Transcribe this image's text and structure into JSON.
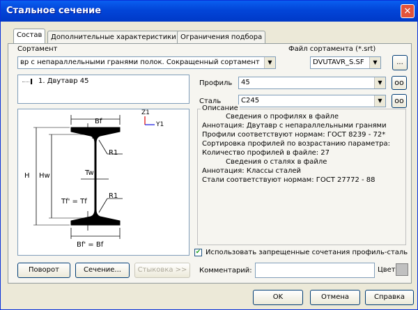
{
  "window": {
    "title": "Стальное сечение",
    "close": "✕"
  },
  "tabs": [
    "Состав",
    "Дополнительные характеристики",
    "Ограничения подбора"
  ],
  "assortment": {
    "label": "Сортамент",
    "value": "вр с непараллельными гранями полок. Сокращенный сортамент",
    "file_label": "Файл сортамента (*.srt)",
    "file_value": "DVUTAVR_S.SF",
    "browse": "..."
  },
  "tree": {
    "item_glyph": "I",
    "item": "1. Двутавр 45"
  },
  "profile": {
    "label": "Профиль",
    "value": "45"
  },
  "steel": {
    "label": "Сталь",
    "value": "C245"
  },
  "figure": {
    "bf": "Bf",
    "tf": "Tf",
    "tw": "Tw",
    "r1_top": "R1",
    "r1_bottom": "R1",
    "tf2": "Tf' = Tf",
    "bf2": "Bf' = Bf",
    "h": "H",
    "hw": "Hw",
    "z1": "Z1",
    "y1": "Y1"
  },
  "description": {
    "legend": "Описание",
    "lines": [
      "Сведения о профилях в файле",
      "Аннотация: Двутавр с непараллельными гранями",
      "Профили соответствуют нормам: ГОСТ 8239 - 72*",
      "Сортировка профилей по возрастанию параметра:",
      "Количество профилей в файле: 27",
      "Сведения о сталях в файле",
      "Аннотация: Классы сталей",
      "Стали соответствуют нормам: ГОСТ 27772 - 88"
    ]
  },
  "checkbox": {
    "label": "Использовать запрещенные сочетания профиль-сталь",
    "checked": true,
    "mark": "✔"
  },
  "buttons": {
    "rotate": "Поворот",
    "section": "Сечение...",
    "join": "Стыковка >>",
    "ok": "OK",
    "cancel": "Отмена",
    "help": "Справка"
  },
  "comment": {
    "label": "Комментарий:",
    "value": ""
  },
  "color": {
    "label": "Цвет:",
    "swatch": "#c0c0c0"
  },
  "icons": {
    "dropdown": "▼",
    "glasses": "oo"
  }
}
